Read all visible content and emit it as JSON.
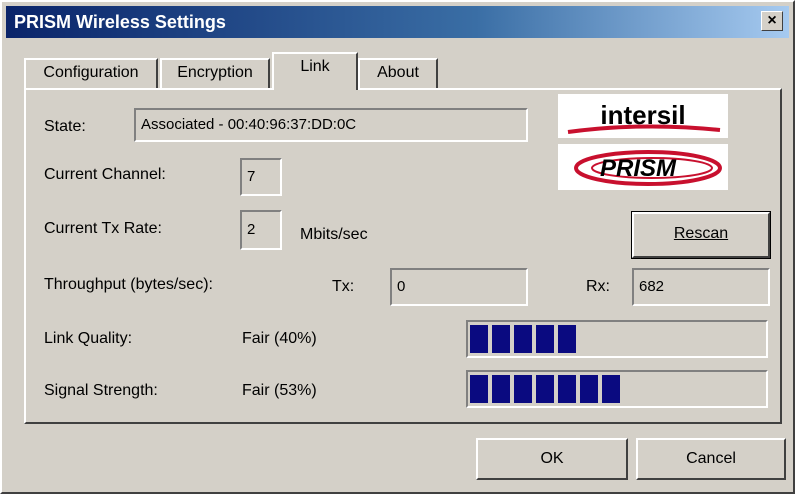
{
  "window": {
    "title": "PRISM Wireless Settings",
    "close_glyph": "×"
  },
  "tabs": [
    {
      "label": "Configuration",
      "active": false
    },
    {
      "label": "Encryption",
      "active": false
    },
    {
      "label": "Link",
      "active": true
    },
    {
      "label": "About",
      "active": false
    }
  ],
  "link": {
    "state_label": "State:",
    "state_value": "Associated - 00:40:96:37:DD:0C",
    "channel_label": "Current Channel:",
    "channel_value": "7",
    "txrate_label": "Current Tx Rate:",
    "txrate_value": "2",
    "txrate_unit": "Mbits/sec",
    "rescan_label": "Rescan",
    "throughput_label": "Throughput (bytes/sec):",
    "tx_label": "Tx:",
    "tx_value": "0",
    "rx_label": "Rx:",
    "rx_value": "682",
    "link_quality_label": "Link Quality:",
    "link_quality_text": "Fair (40%)",
    "link_quality_percent": 40,
    "signal_strength_label": "Signal Strength:",
    "signal_strength_text": "Fair (53%)",
    "signal_strength_percent": 53
  },
  "logos": {
    "intersil": "intersil",
    "prism": "PRISM"
  },
  "buttons": {
    "ok": "OK",
    "cancel": "Cancel"
  },
  "colors": {
    "bar_fill": "#0a0a80",
    "title_start": "#0a246a",
    "title_end": "#a6caf0"
  }
}
